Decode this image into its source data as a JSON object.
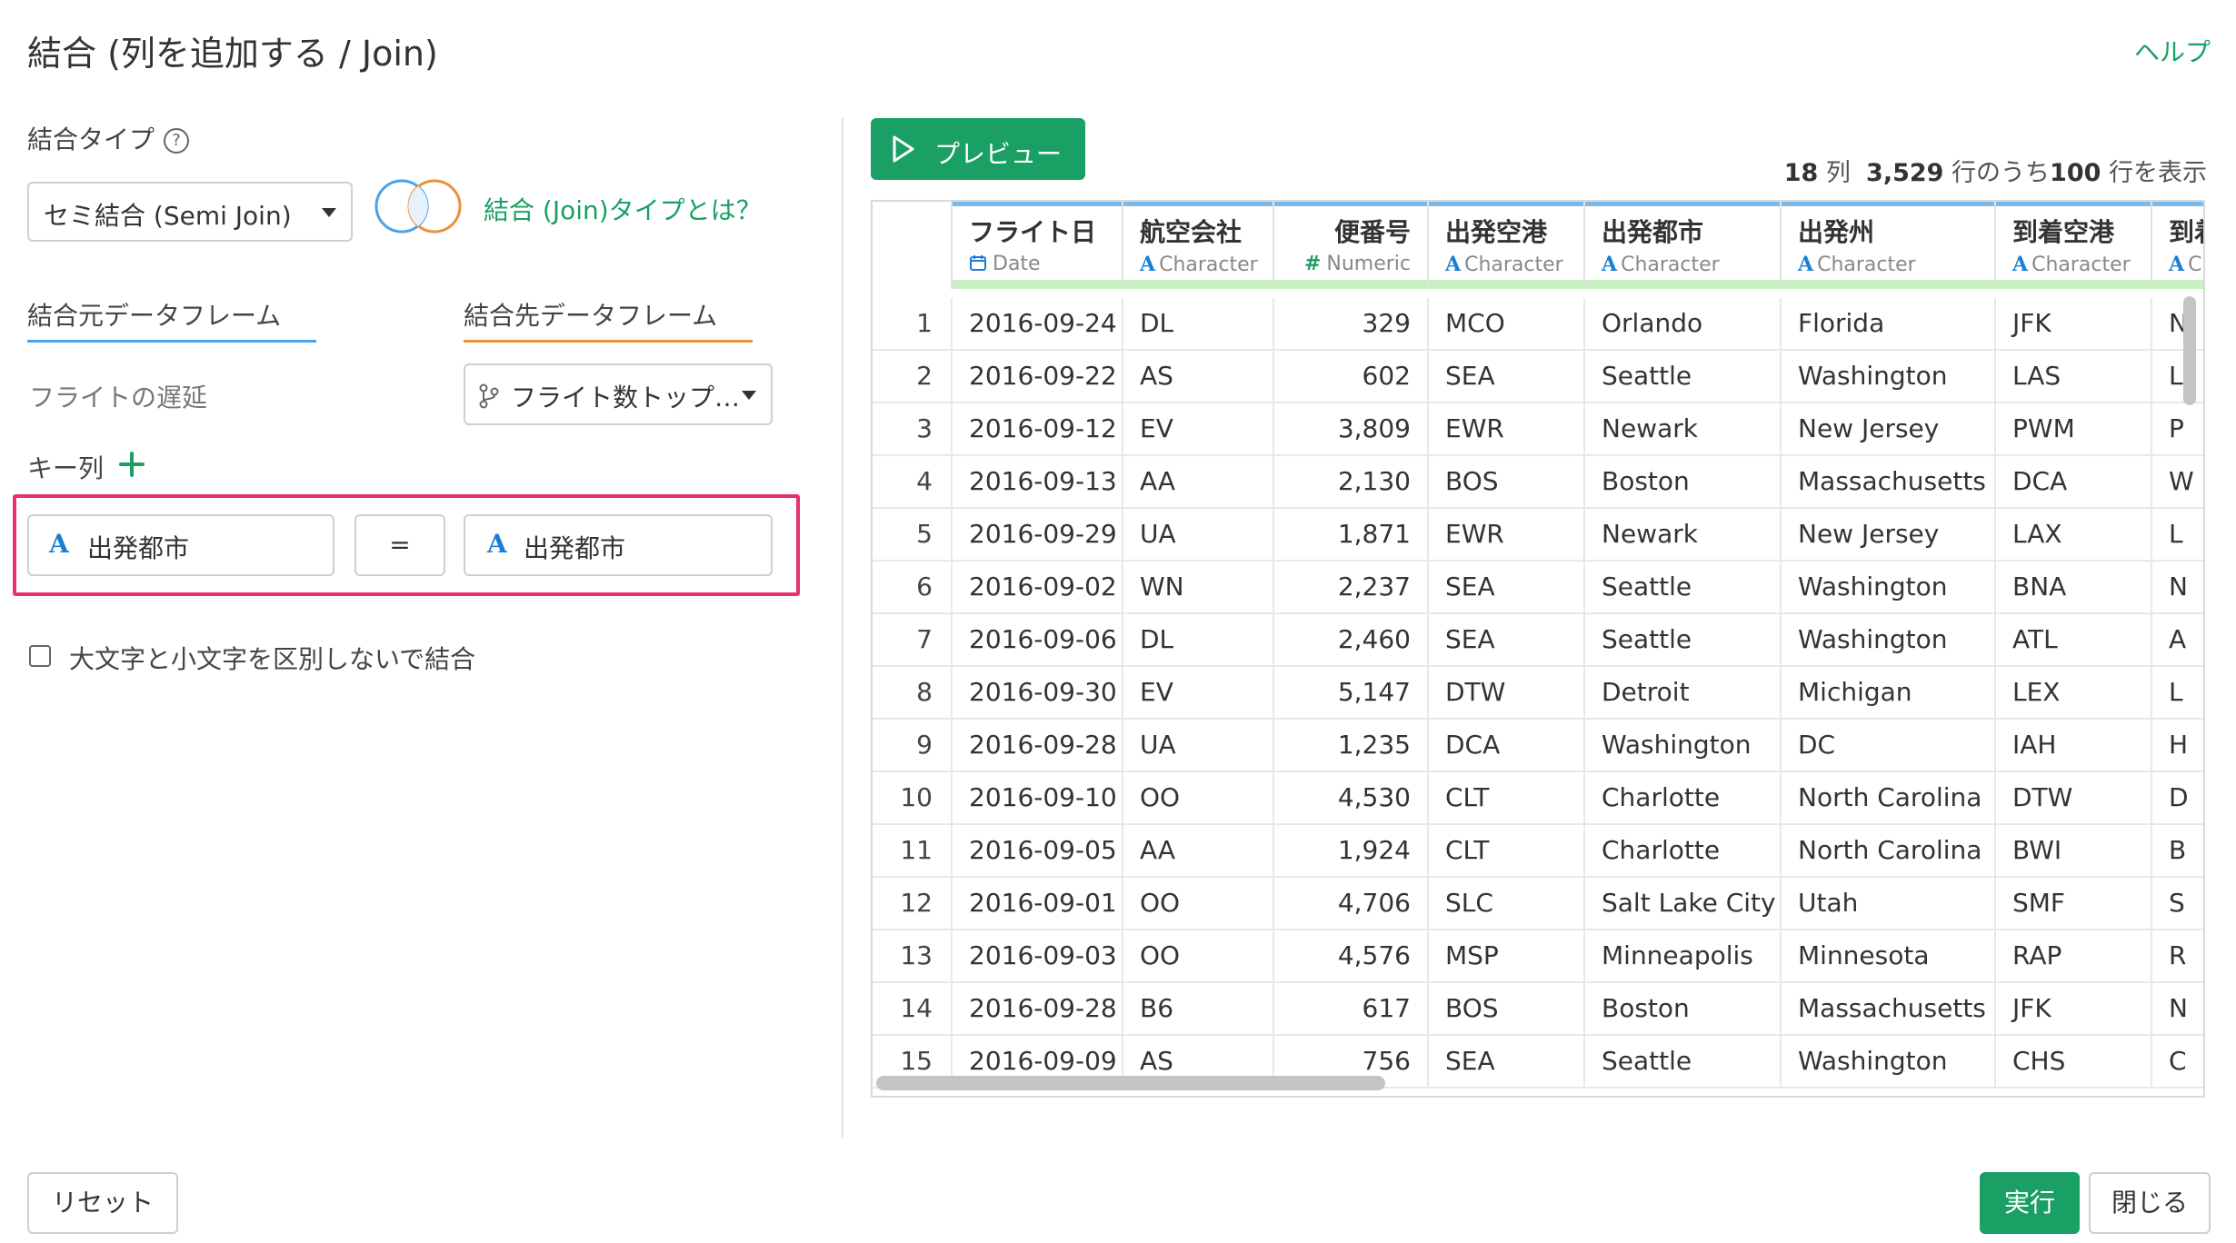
{
  "dialog": {
    "title": "結合 (列を追加する / Join)",
    "help_link": "ヘルプ"
  },
  "join_type": {
    "label": "結合タイプ",
    "help_icon": "question-circle-icon",
    "selected": "セミ結合 (Semi Join)",
    "about_link": "結合 (Join)タイプとは？",
    "venn_icon": "venn-diagram-icon"
  },
  "frames": {
    "source_tab": "結合元データフレーム",
    "target_tab": "結合先データフレーム",
    "source_name": "フライトの遅延",
    "target_selected": "フライト数トップ…",
    "target_icon": "branch-icon",
    "source_color": "#4aa3e8",
    "target_color": "#e8923a"
  },
  "keys": {
    "label": "キー列",
    "add_icon": "plus-icon",
    "type_glyph": "A",
    "left": "出発都市",
    "operator": "=",
    "right": "出発都市"
  },
  "options": {
    "ignore_case_label": "大文字と小文字を区別しないで結合",
    "ignore_case_checked": false
  },
  "preview": {
    "button_label": "プレビュー",
    "play_icon": "play-icon",
    "summary": {
      "cols": "18",
      "cols_unit": "列",
      "rows_total": "3,529",
      "rows_mid": "行のうち",
      "rows_shown": "100",
      "rows_tail": "行を表示"
    }
  },
  "table": {
    "columns": [
      {
        "name": "フライト日",
        "type": "Date",
        "type_icon": "calendar-icon"
      },
      {
        "name": "航空会社",
        "type": "Character",
        "type_icon": "A"
      },
      {
        "name": "便番号",
        "type": "Numeric",
        "type_icon": "#"
      },
      {
        "name": "出発空港",
        "type": "Character",
        "type_icon": "A"
      },
      {
        "name": "出発都市",
        "type": "Character",
        "type_icon": "A"
      },
      {
        "name": "出発州",
        "type": "Character",
        "type_icon": "A"
      },
      {
        "name": "到着空港",
        "type": "Character",
        "type_icon": "A"
      },
      {
        "name": "到着",
        "type": "Cl",
        "type_icon": "A"
      }
    ],
    "rows": [
      [
        "1",
        "2016-09-24",
        "DL",
        "329",
        "MCO",
        "Orlando",
        "Florida",
        "JFK",
        "N"
      ],
      [
        "2",
        "2016-09-22",
        "AS",
        "602",
        "SEA",
        "Seattle",
        "Washington",
        "LAS",
        "L"
      ],
      [
        "3",
        "2016-09-12",
        "EV",
        "3,809",
        "EWR",
        "Newark",
        "New Jersey",
        "PWM",
        "P"
      ],
      [
        "4",
        "2016-09-13",
        "AA",
        "2,130",
        "BOS",
        "Boston",
        "Massachusetts",
        "DCA",
        "W"
      ],
      [
        "5",
        "2016-09-29",
        "UA",
        "1,871",
        "EWR",
        "Newark",
        "New Jersey",
        "LAX",
        "L"
      ],
      [
        "6",
        "2016-09-02",
        "WN",
        "2,237",
        "SEA",
        "Seattle",
        "Washington",
        "BNA",
        "N"
      ],
      [
        "7",
        "2016-09-06",
        "DL",
        "2,460",
        "SEA",
        "Seattle",
        "Washington",
        "ATL",
        "A"
      ],
      [
        "8",
        "2016-09-30",
        "EV",
        "5,147",
        "DTW",
        "Detroit",
        "Michigan",
        "LEX",
        "L"
      ],
      [
        "9",
        "2016-09-28",
        "UA",
        "1,235",
        "DCA",
        "Washington",
        "DC",
        "IAH",
        "H"
      ],
      [
        "10",
        "2016-09-10",
        "OO",
        "4,530",
        "CLT",
        "Charlotte",
        "North Carolina",
        "DTW",
        "D"
      ],
      [
        "11",
        "2016-09-05",
        "AA",
        "1,924",
        "CLT",
        "Charlotte",
        "North Carolina",
        "BWI",
        "B"
      ],
      [
        "12",
        "2016-09-01",
        "OO",
        "4,706",
        "SLC",
        "Salt Lake City",
        "Utah",
        "SMF",
        "S"
      ],
      [
        "13",
        "2016-09-03",
        "OO",
        "4,576",
        "MSP",
        "Minneapolis",
        "Minnesota",
        "RAP",
        "R"
      ],
      [
        "14",
        "2016-09-28",
        "B6",
        "617",
        "BOS",
        "Boston",
        "Massachusetts",
        "JFK",
        "N"
      ],
      [
        "15",
        "2016-09-09",
        "AS",
        "756",
        "SEA",
        "Seattle",
        "Washington",
        "CHS",
        "C"
      ]
    ]
  },
  "footer": {
    "reset": "リセット",
    "run": "実行",
    "close": "閉じる"
  }
}
